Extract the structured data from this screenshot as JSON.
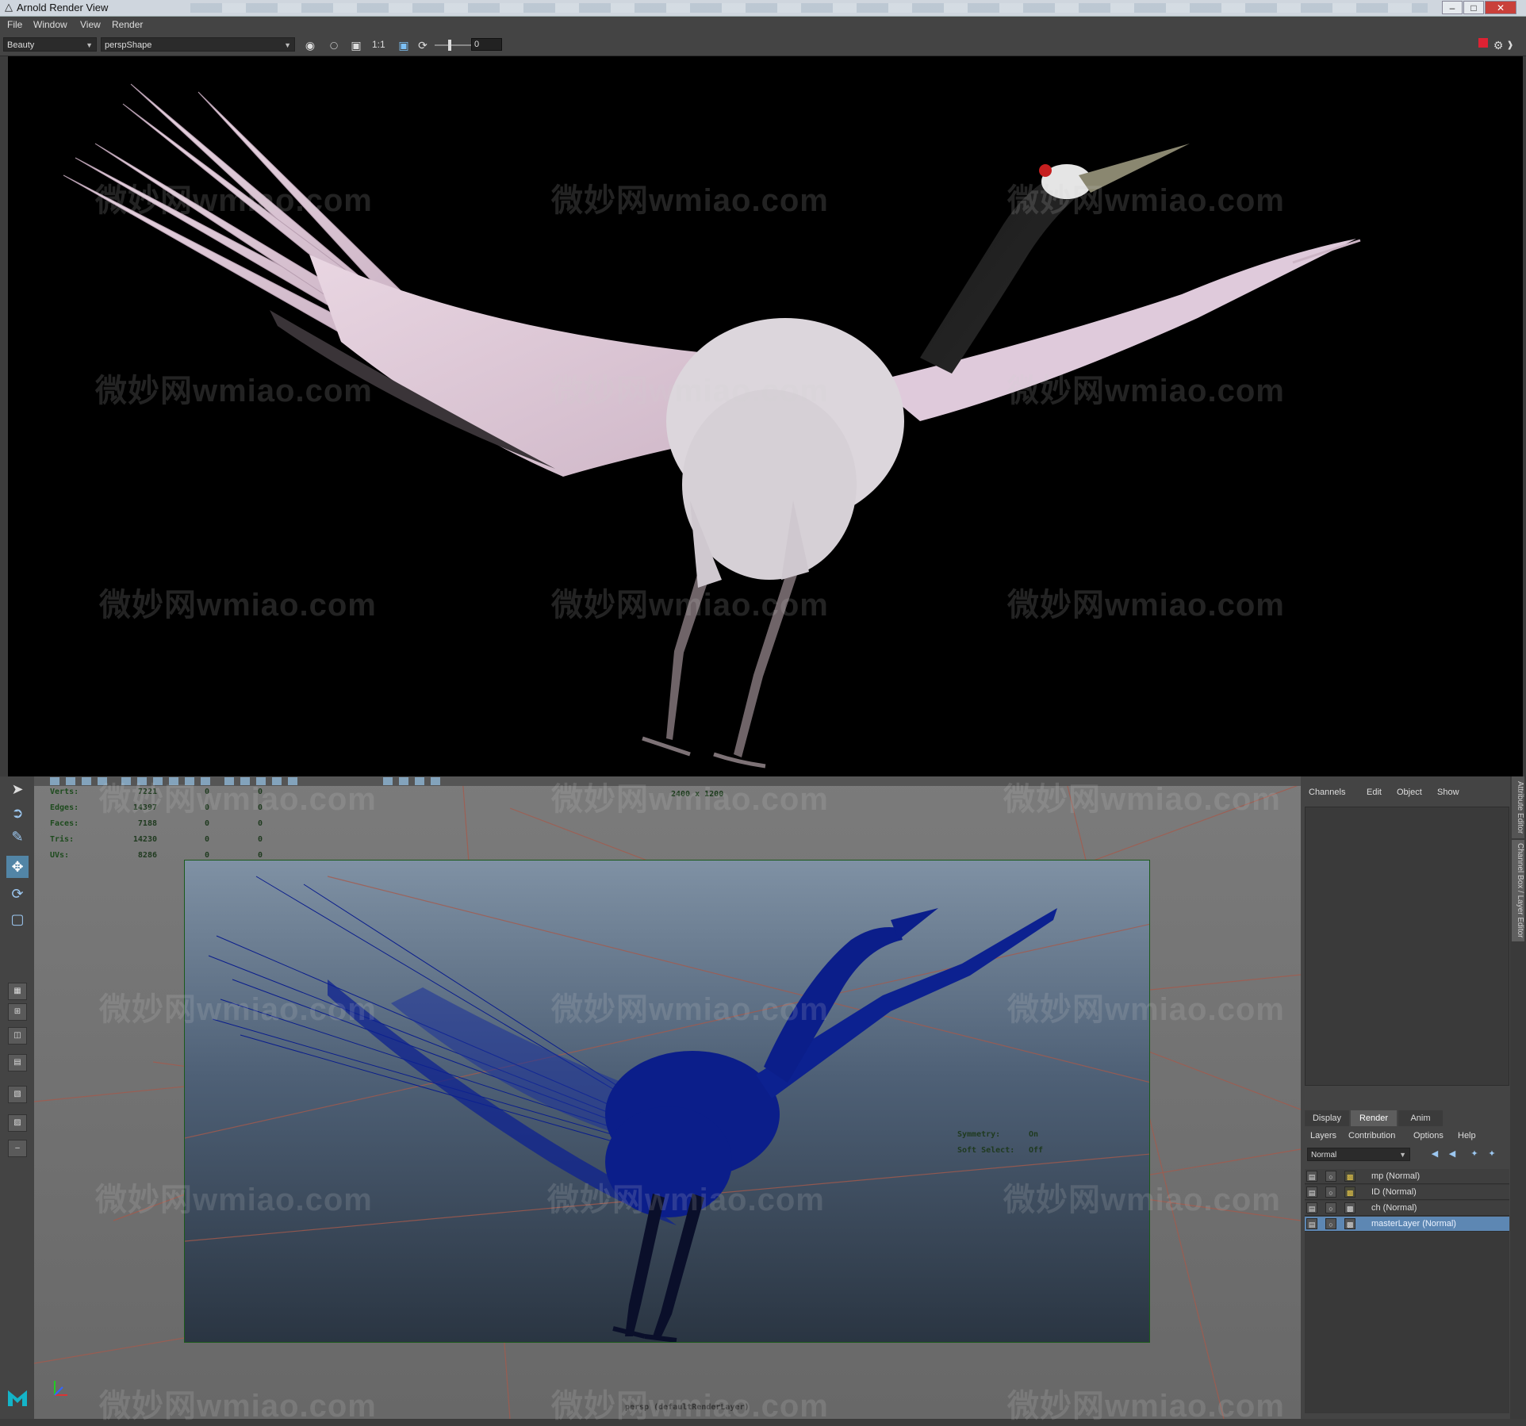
{
  "window": {
    "title": "Arnold Render View",
    "minimize_glyph": "–",
    "maximize_glyph": "□",
    "close_glyph": "✕"
  },
  "menubar": [
    "File",
    "Window",
    "View",
    "Render"
  ],
  "render_toolbar": {
    "aov_select": "Beauty",
    "camera_select": "perspShape",
    "zoom_label": "1:1",
    "exposure_value": "0",
    "icons": [
      "display-settings-icon",
      "rgb-channel-icon",
      "checker-icon",
      "crop-region-icon",
      "refresh-icon",
      "stop-render-icon",
      "settings-gear-icon"
    ]
  },
  "watermark": "微妙网wmiao.com",
  "viewport": {
    "resolution_gate": "2400 x 1200",
    "camera_label": "persp (defaultRenderLayer)",
    "hud_stats": [
      {
        "label": "Verts:",
        "value": "7221",
        "a": "0",
        "b": "0"
      },
      {
        "label": "Edges:",
        "value": "14397",
        "a": "0",
        "b": "0"
      },
      {
        "label": "Faces:",
        "value": "7188",
        "a": "0",
        "b": "0"
      },
      {
        "label": "Tris:",
        "value": "14230",
        "a": "0",
        "b": "0"
      },
      {
        "label": "UVs:",
        "value": "8286",
        "a": "0",
        "b": "0"
      }
    ],
    "symmetry_label": "Symmetry:",
    "symmetry_value": "On",
    "soft_select_label": "Soft Select:",
    "soft_select_value": "Off"
  },
  "channel_box": {
    "menus": [
      "Channels",
      "Edit",
      "Object",
      "Show"
    ],
    "side_tabs": [
      "Attribute Editor",
      "Channel Box / Layer Editor"
    ]
  },
  "layer_editor": {
    "tabs": [
      "Display",
      "Render",
      "Anim"
    ],
    "active_tab": "Render",
    "menus": [
      "Layers",
      "Contribution",
      "Options",
      "Help"
    ],
    "blend_mode": "Normal",
    "layers": [
      {
        "name": "mp (Normal)",
        "selected": false
      },
      {
        "name": "ID (Normal)",
        "selected": false
      },
      {
        "name": "ch (Normal)",
        "selected": false
      },
      {
        "name": "masterLayer (Normal)",
        "selected": true
      }
    ]
  },
  "colors": {
    "render_bg": "#000000",
    "selection_blue": "#5d87b3",
    "wireframe_blue": "#0b1e8a",
    "gate_border": "#1b5a1b",
    "grid_red": "#b0483c"
  }
}
